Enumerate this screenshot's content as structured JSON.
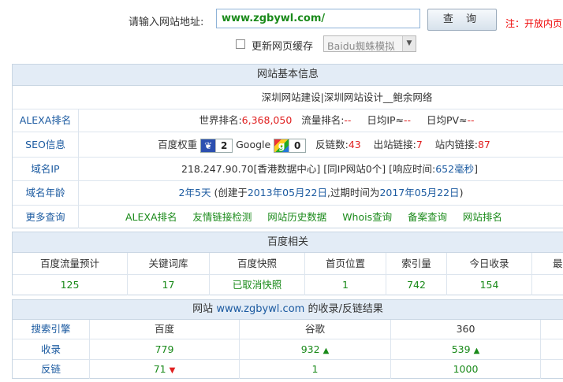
{
  "top": {
    "url_label": "请输入网站地址:",
    "url_value": "www.zgbywl.com/",
    "query_button": "查 询",
    "note": "注：开放内页",
    "refresh_cache_label": "更新网页缓存",
    "simulate_select": "Baidu蜘蛛模拟"
  },
  "basic": {
    "title": "网站基本信息",
    "site_title": "深圳网站建设|深圳网站设计__鲍余网络",
    "alexa": {
      "label": "ALEXA排名",
      "world_rank_label": "世界排名:",
      "world_rank": "6,368,050",
      "traffic_rank_label": "流量排名:",
      "traffic_rank": "--",
      "daily_ip_label": "日均IP≈",
      "daily_ip": "--",
      "daily_pv_label": "日均PV≈",
      "daily_pv": "--"
    },
    "seo": {
      "label": "SEO信息",
      "baidu_weight_label": "百度权重",
      "baidu_weight": "2",
      "google_label": "Google",
      "google_pr": "0",
      "backlinks_label": "反链数:",
      "backlinks": "43",
      "outlinks_label": "出站链接:",
      "outlinks": "7",
      "inlinks_label": "站内链接:",
      "inlinks": "87"
    },
    "domain_ip": {
      "label": "域名IP",
      "ip": "218.247.90.70[香港数据中心]",
      "same_ip": "[同IP网站0个]",
      "response_label": "[响应时间:",
      "response_value": "652毫秒",
      "response_end": "]"
    },
    "domain_age": {
      "label": "域名年龄",
      "age": "2年5天",
      "created_prefix": "(创建于",
      "created": "2013年05月22日",
      "expire_prefix": ",过期时间为",
      "expire": "2017年05月22日",
      "suffix": ")"
    },
    "more": {
      "label": "更多查询",
      "links": [
        "ALEXA排名",
        "友情链接检测",
        "网站历史数据",
        "Whois查询",
        "备案查询",
        "网站排名"
      ]
    }
  },
  "baidu": {
    "title": "百度相关",
    "headers": [
      "百度流量预计",
      "关键词库",
      "百度快照",
      "首页位置",
      "索引量",
      "今日收录",
      "最"
    ],
    "values": [
      "125",
      "17",
      "已取消快照",
      "1",
      "742",
      "154",
      ""
    ]
  },
  "index": {
    "title_prefix": "网站",
    "title_site": "www.zgbywl.com",
    "title_suffix": "的收录/反链结果",
    "headers": [
      "搜索引擎",
      "百度",
      "谷歌",
      "360"
    ],
    "rows": [
      {
        "label": "收录",
        "baidu": "779",
        "google": "932",
        "s360": "539"
      },
      {
        "label": "反链",
        "baidu": "71",
        "google": "1",
        "s360": "1000"
      }
    ]
  },
  "colors": {
    "accent_blue": "#1b5aa0",
    "green": "#1a8a1a",
    "red": "#e02020",
    "header_bg": "#e3ecf6"
  }
}
